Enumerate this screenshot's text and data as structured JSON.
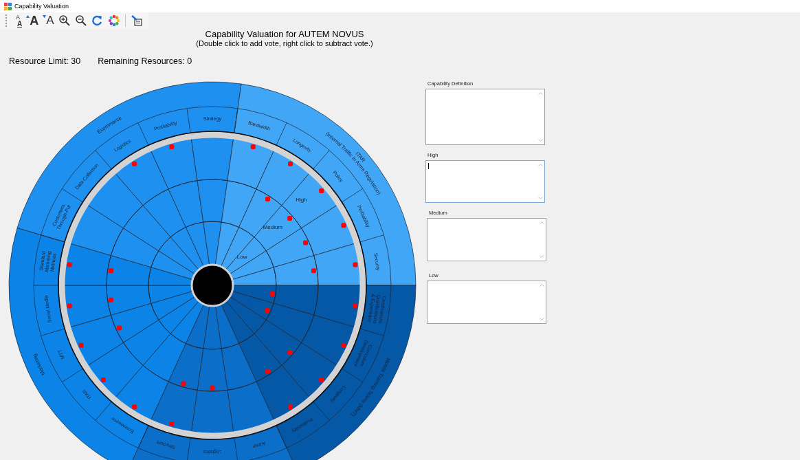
{
  "window": {
    "title": "Capability Valuation"
  },
  "toolbar": [
    {
      "kind": "font-style",
      "glyphs": [
        "A",
        "A"
      ]
    },
    {
      "kind": "grow-font",
      "glyphs": [
        "A"
      ]
    },
    {
      "kind": "shrink-font",
      "glyphs": [
        "A"
      ]
    },
    {
      "kind": "zoom-in"
    },
    {
      "kind": "zoom-out"
    },
    {
      "kind": "refresh"
    },
    {
      "kind": "colors"
    },
    {
      "kind": "separator"
    },
    {
      "kind": "export"
    }
  ],
  "header": {
    "title": "Capability Valuation for AUTEM NOVUS",
    "hint": "(Double click to add vote, right click to subtract vote.)"
  },
  "resources": {
    "limit": "Resource Limit: 30",
    "remaining": "Remaining Resources: 0"
  },
  "wheel": {
    "rings": [
      {
        "label": "Low"
      },
      {
        "label": "Medium"
      },
      {
        "label": "High"
      }
    ],
    "sections": [
      {
        "category": "Ecommerce",
        "color": "#1e90f0",
        "segments": [
          {
            "label": "Customers\nThrough-Put",
            "votes": {
              "high": false,
              "medium": false,
              "low": false
            }
          },
          {
            "label": "Data Collection",
            "votes": {
              "high": false,
              "medium": false,
              "low": false
            }
          },
          {
            "label": "Logistics",
            "votes": {
              "high": true,
              "medium": false,
              "low": false
            }
          },
          {
            "label": "Profitability",
            "votes": {
              "high": true,
              "medium": false,
              "low": false
            }
          },
          {
            "label": "Strategy",
            "votes": {
              "high": false,
              "medium": false,
              "low": false
            }
          }
        ]
      },
      {
        "category": "ITAR\n(Internal Traffic in Arms Regulation)",
        "color": "#42a6f6",
        "segments": [
          {
            "label": "Bandwidth",
            "votes": {
              "high": true,
              "medium": false,
              "low": false
            }
          },
          {
            "label": "Longevity",
            "votes": {
              "high": true,
              "medium": true,
              "low": false
            }
          },
          {
            "label": "Policy",
            "votes": {
              "high": true,
              "medium": true,
              "low": false
            }
          },
          {
            "label": "Profitability",
            "votes": {
              "high": true,
              "medium": true,
              "low": false
            }
          },
          {
            "label": "Security",
            "votes": {
              "high": true,
              "medium": true,
              "low": false
            }
          }
        ]
      },
      {
        "category": "Mobile Training Teams (MMT)",
        "color": "#0558a6",
        "segments": [
          {
            "label": "Certifications\nQualifications\n& Experience",
            "votes": {
              "high": true,
              "medium": false,
              "low": true
            }
          },
          {
            "label": "Curriculum\nDevelopment",
            "votes": {
              "high": true,
              "medium": false,
              "low": true
            }
          },
          {
            "label": "Longevity",
            "votes": {
              "high": true,
              "medium": true,
              "low": false
            }
          },
          {
            "label": "Profitability",
            "votes": {
              "high": true,
              "medium": true,
              "low": false
            }
          }
        ]
      },
      {
        "color": "#0b6fc9",
        "segments": [
          {
            "label": "Admin",
            "votes": {
              "high": false,
              "medium": false,
              "low": false
            }
          },
          {
            "label": "Logistics",
            "votes": {
              "high": false,
              "medium": true,
              "low": false
            }
          },
          {
            "label": "Structure",
            "votes": {
              "high": true,
              "medium": true,
              "low": false
            }
          }
        ]
      },
      {
        "category": "Marketing",
        "color": "#0c83e6",
        "segments": [
          {
            "label": "Ecommerce",
            "votes": {
              "high": true,
              "medium": false,
              "low": false
            }
          },
          {
            "label": "ITAR",
            "votes": {
              "high": true,
              "medium": false,
              "low": false
            }
          },
          {
            "label": "MTT",
            "votes": {
              "high": true,
              "medium": true,
              "low": false
            }
          },
          {
            "label": "Social Media",
            "votes": {
              "high": true,
              "medium": true,
              "low": false
            }
          },
          {
            "label": "Standard\nMarketing\nMethods",
            "votes": {
              "high": true,
              "medium": true,
              "low": false
            }
          }
        ]
      }
    ]
  },
  "fields": [
    {
      "label": "Capability Definition",
      "focused": false
    },
    {
      "label": "High",
      "focused": true
    },
    {
      "label": "Medium",
      "focused": false
    },
    {
      "label": "Low",
      "focused": false
    }
  ]
}
